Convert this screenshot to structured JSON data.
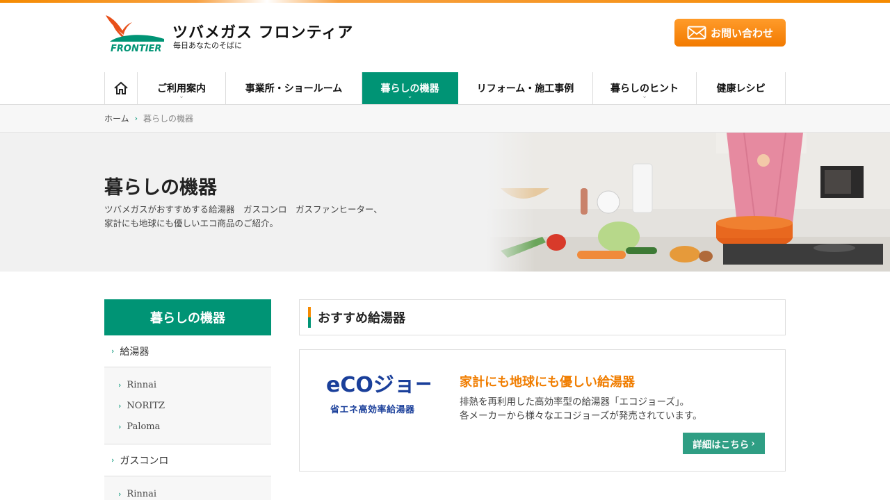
{
  "brand": {
    "logo_wordmark": "FRONTIER",
    "name": "ツバメガス フロンティア",
    "tagline": "毎日あなたのそばに",
    "contact_label": "お問い合わせ"
  },
  "nav": {
    "items": [
      {
        "label": "",
        "icon": "home-icon"
      },
      {
        "label": "ご利用案内",
        "has_sub": true
      },
      {
        "label": "事業所・ショールーム"
      },
      {
        "label": "暮らしの機器",
        "has_sub": true,
        "active": true
      },
      {
        "label": "リフォーム・施工事例"
      },
      {
        "label": "暮らしのヒント",
        "has_sub": true
      },
      {
        "label": "健康レシピ"
      }
    ],
    "caret": "⌄"
  },
  "breadcrumb": {
    "home": "ホーム",
    "separator": "›",
    "current": "暮らしの機器"
  },
  "hero": {
    "title": "暮らしの機器",
    "desc_line1": "ツバメガスがおすすめする給湯器　ガスコンロ　ガスファンヒーター、",
    "desc_line2": "家計にも地球にも優しいエコ商品のご紹介。"
  },
  "sidebar": {
    "title": "暮らしの機器",
    "arrow": "›",
    "categories": [
      {
        "label": "給湯器",
        "subs": [
          "Rinnai",
          "NORITZ",
          "Paloma"
        ]
      },
      {
        "label": "ガスコンロ",
        "subs": [
          "Rinnai"
        ]
      }
    ]
  },
  "section": {
    "heading": "おすすめ給湯器"
  },
  "card": {
    "logo_word": "eCOジョーズ",
    "logo_caption": "省エネ高効率給湯器",
    "title": "家計にも地球にも優しい給湯器",
    "body_line1": "排熱を再利用した高効率型の給湯器「エコジョーズ」。",
    "body_line2": "各メーカーから様々なエコジョーズが発売されています。",
    "button_label": "詳細はこちら",
    "button_arrow": "›"
  },
  "colors": {
    "accent_green": "#009475",
    "accent_orange": "#f58a00",
    "eco_blue": "#1a3f9a"
  }
}
